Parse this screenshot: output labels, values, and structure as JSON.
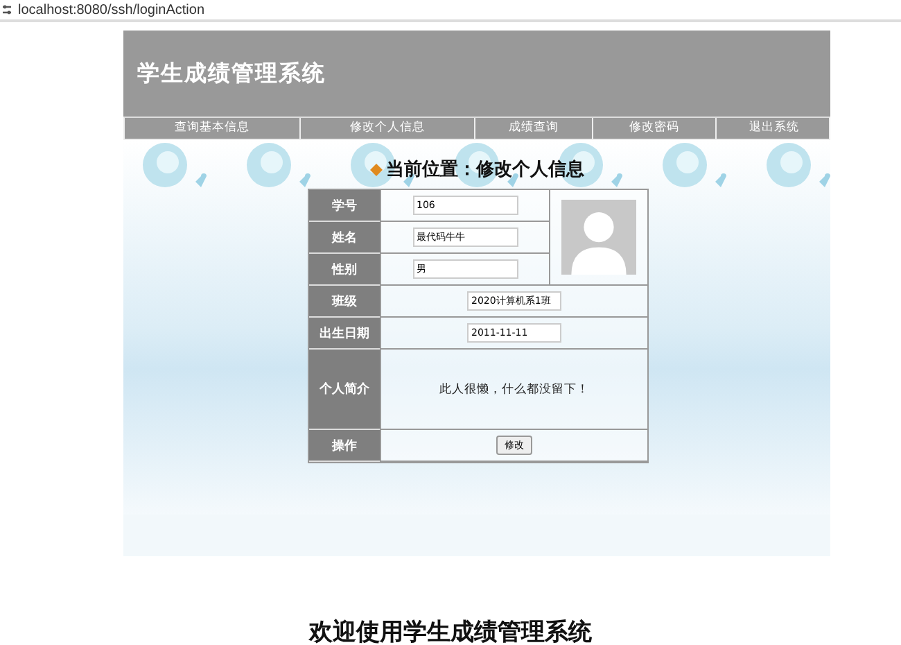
{
  "address_bar": {
    "url": "localhost:8080/ssh/loginAction"
  },
  "header": {
    "title": "学生成绩管理系统"
  },
  "nav": [
    {
      "label": "查询基本信息"
    },
    {
      "label": "修改个人信息"
    },
    {
      "label": "成绩查询"
    },
    {
      "label": "修改密码"
    },
    {
      "label": "退出系统"
    }
  ],
  "breadcrumb": "当前位置：修改个人信息",
  "form": {
    "fields": [
      {
        "label": "学号",
        "value": "106",
        "kind": "short"
      },
      {
        "label": "姓名",
        "value": "最代码牛牛",
        "kind": "short"
      },
      {
        "label": "性别",
        "value": "男",
        "kind": "short"
      },
      {
        "label": "班级",
        "value": "2020计算机系1班",
        "kind": "wide"
      },
      {
        "label": "出生日期",
        "value": "2011-11-11",
        "kind": "wide"
      }
    ],
    "intro": {
      "label": "个人简介",
      "text": "此人很懒，什么都没留下！"
    },
    "action": {
      "label": "操作",
      "button": "修改"
    }
  },
  "footer": "欢迎使用学生成绩管理系统"
}
